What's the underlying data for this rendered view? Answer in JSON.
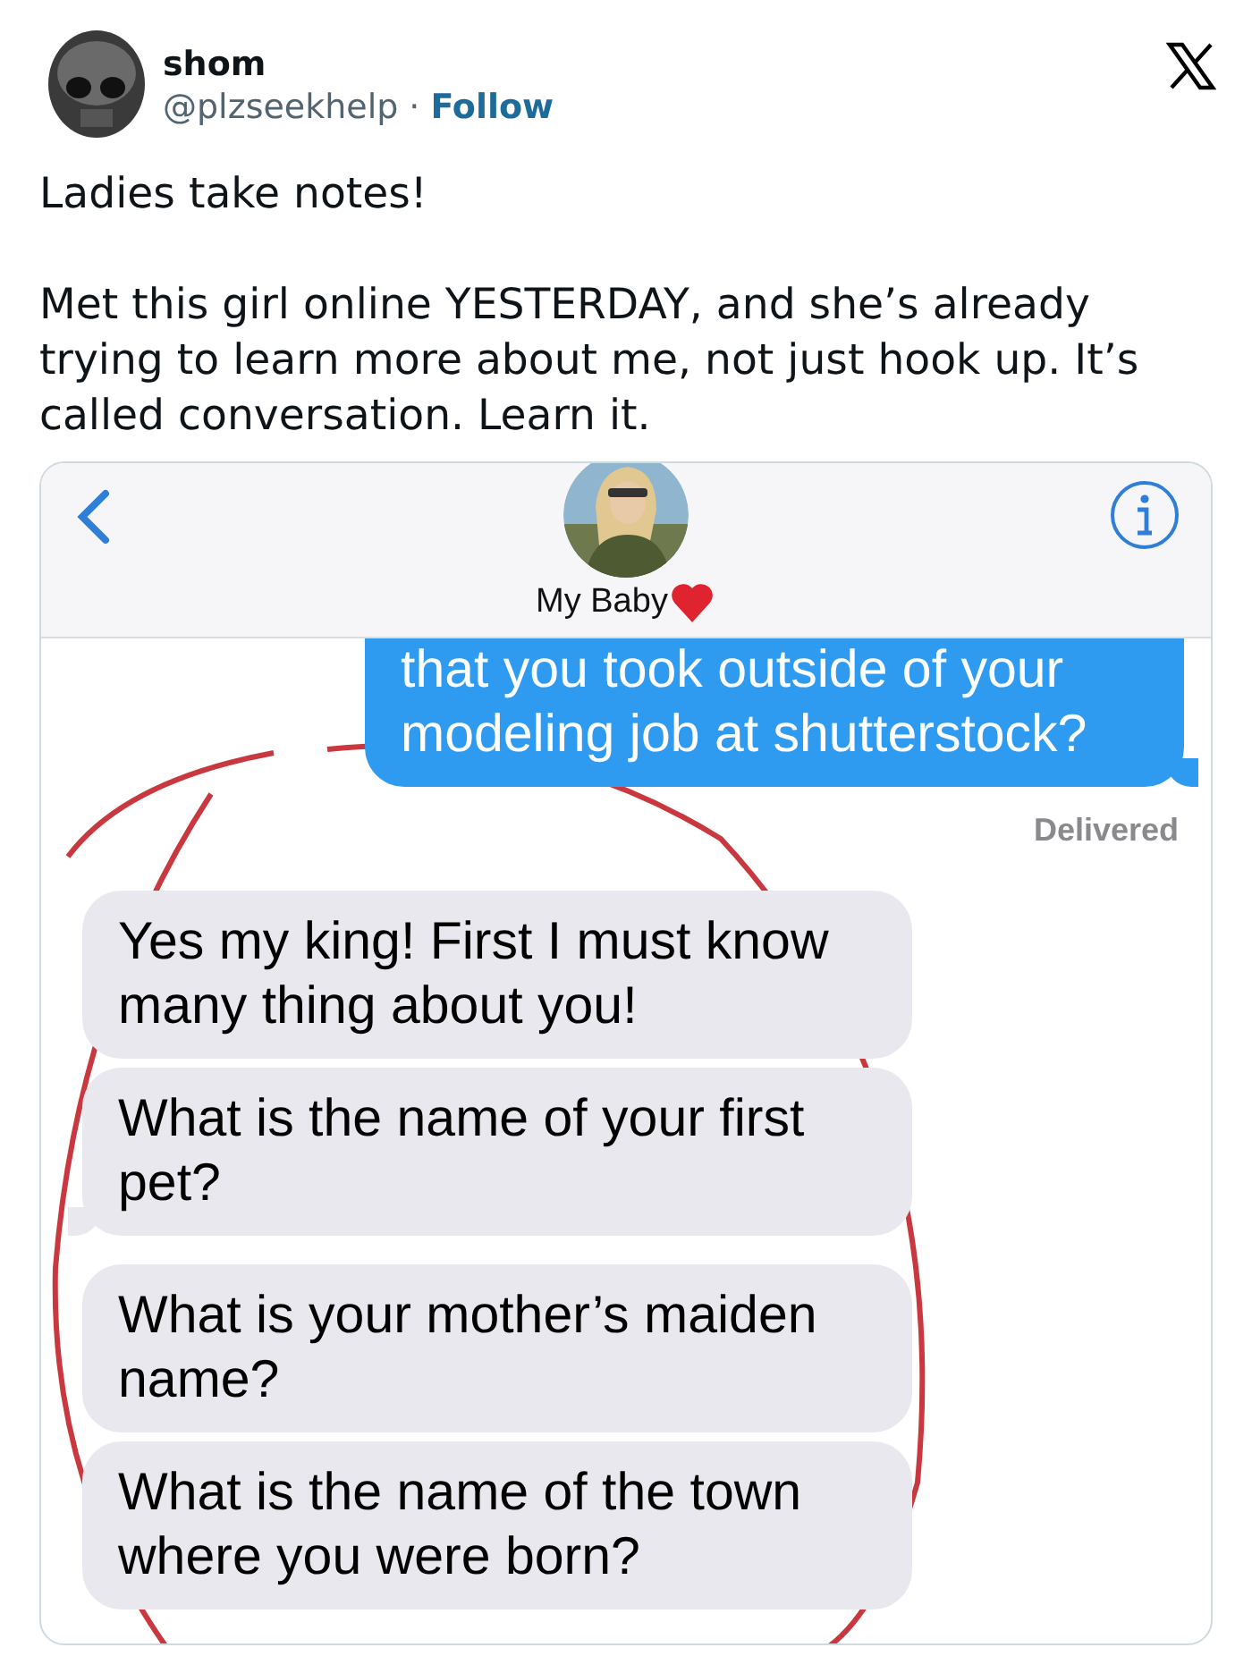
{
  "tweet": {
    "author": {
      "name": "shom",
      "handle": "@plzseekhelp",
      "separator": "·",
      "follow": "Follow"
    },
    "paragraphs": [
      "Ladies take notes!",
      "Met this girl online YESTERDAY, and she’s already trying to learn more about me, not just hook up. It’s called conversation. Learn it."
    ]
  },
  "screenshot": {
    "contact_name": "My Baby",
    "messages": [
      {
        "kind": "sent",
        "text": "that you took outside of your modeling job at shutterstock?",
        "tail": true
      },
      {
        "kind": "status",
        "text": "Delivered"
      },
      {
        "kind": "received",
        "text": "Yes my king! First I must know many thing about you!",
        "tail": false
      },
      {
        "kind": "received",
        "text": "What is the name of your first pet?",
        "tail": true
      },
      {
        "kind": "received",
        "text": "What is your mother’s maiden name?",
        "tail": false
      },
      {
        "kind": "received",
        "text": "What is the name of the town where you were born?",
        "tail": false
      }
    ]
  }
}
